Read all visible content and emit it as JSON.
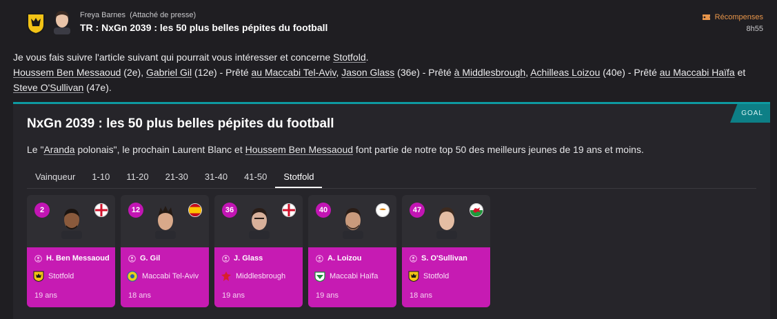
{
  "message": {
    "sender_name": "Freya Barnes",
    "sender_role": "(Attaché de presse)",
    "subject": "TR : NxGn 2039 : les 50 plus belles pépites du football",
    "rewards_label": "Récompenses",
    "time": "8h55"
  },
  "body": {
    "intro": "Je vous fais suivre l'article suivant qui pourrait vous intéresser et concerne",
    "intro_link": "Stotfold",
    "intro_end": ".",
    "p1": "Houssem Ben Messaoud",
    "p1_rank": " (2e), ",
    "p2": "Gabriel Gil",
    "p2_rank": " (12e) - Prêté ",
    "p2_loan": "au Maccabi Tel-Aviv",
    "sep1": ", ",
    "p3": "Jason Glass",
    "p3_rank": " (36e) - Prêté ",
    "p3_loan": "à Middlesbrough",
    "sep2": ", ",
    "p4": "Achilleas Loizou",
    "p4_rank": " (40e) - Prêté ",
    "p4_loan": "au Maccabi Haïfa",
    "and": " et ",
    "p5": "Steve O'Sullivan",
    "p5_rank": " (47e)."
  },
  "article": {
    "tag": "GOAL",
    "title": "NxGn 2039 : les 50 plus belles pépites du football",
    "desc_1": "Le \"",
    "desc_link1": "Aranda",
    "desc_2": " polonais\", le prochain Laurent Blanc et ",
    "desc_link2": "Houssem Ben Messaoud",
    "desc_3": " font partie de notre top 50 des meilleurs jeunes de 19 ans et moins.",
    "tabs": [
      "Vainqueur",
      "1-10",
      "11-20",
      "21-30",
      "31-40",
      "41-50",
      "Stotfold"
    ],
    "active_tab": "Stotfold"
  },
  "players": [
    {
      "rank": "2",
      "name": "H. Ben Messaoud",
      "club": "Stotfold",
      "age": "19 ans",
      "flag": "england",
      "club_badge": "stotfold-badge"
    },
    {
      "rank": "12",
      "name": "G. Gil",
      "club": "Maccabi Tel-Aviv",
      "age": "18 ans",
      "flag": "spain",
      "club_badge": "maccabi-tel-aviv-badge"
    },
    {
      "rank": "36",
      "name": "J. Glass",
      "club": "Middlesbrough",
      "age": "19 ans",
      "flag": "england",
      "club_badge": "middlesbrough-badge"
    },
    {
      "rank": "40",
      "name": "A. Loizou",
      "club": "Maccabi Haïfa",
      "age": "19 ans",
      "flag": "cyprus",
      "club_badge": "maccabi-haifa-badge"
    },
    {
      "rank": "47",
      "name": "S. O'Sullivan",
      "club": "Stotfold",
      "age": "18 ans",
      "flag": "wales",
      "club_badge": "stotfold-badge"
    }
  ],
  "colors": {
    "accent_teal": "#0e9aa1",
    "card_magenta": "#c61bb3",
    "rewards_orange": "#e8954a"
  }
}
